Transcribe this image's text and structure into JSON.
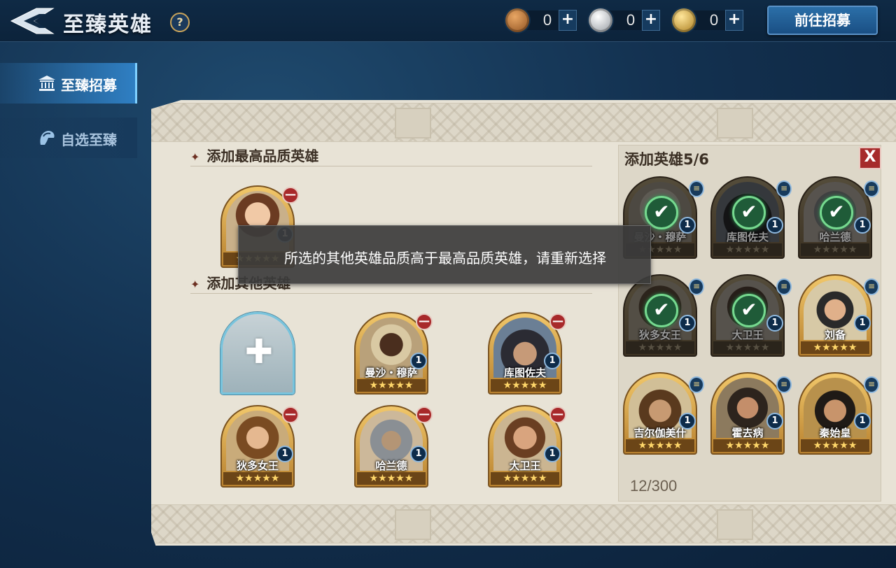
{
  "header": {
    "title": "至臻英雄",
    "help": "?",
    "currencies": [
      {
        "name": "bronze-coin",
        "amount": "0",
        "color": "#b8742e"
      },
      {
        "name": "silver-coin",
        "amount": "0",
        "color": "#c8ccd1"
      },
      {
        "name": "gold-coin",
        "amount": "0",
        "color": "#e2b54a"
      }
    ],
    "plus": "+",
    "go_recruit": "前往招募"
  },
  "side_tabs": [
    {
      "label": "至臻招募",
      "icon": "temple-icon",
      "active": true
    },
    {
      "label": "自选至臻",
      "icon": "helmet-icon",
      "active": false
    }
  ],
  "left": {
    "section1_title": "添加最高品质英雄",
    "section2_title": "添加其他英雄",
    "star_glyph": "✦",
    "top_hero": {
      "name": "",
      "level": "1"
    },
    "other_heroes": [
      {
        "name": "曼沙・穆萨",
        "level": "1"
      },
      {
        "name": "库图佐夫",
        "level": "1"
      },
      {
        "name": "狄多女王",
        "level": "1"
      },
      {
        "name": "哈兰德",
        "level": "1"
      },
      {
        "name": "大卫王",
        "level": "1"
      }
    ],
    "remove_glyph": "—",
    "add_glyph": "✚"
  },
  "right": {
    "title": "添加英雄5/6",
    "close": "X",
    "count": "12/300",
    "check_glyph": "✔",
    "doc_glyph": "≡",
    "stars": "★★★★★",
    "heroes": [
      {
        "name": "曼沙・穆萨",
        "level": "1",
        "selected": true
      },
      {
        "name": "库图佐夫",
        "level": "1",
        "selected": true
      },
      {
        "name": "哈兰德",
        "level": "1",
        "selected": true
      },
      {
        "name": "狄多女王",
        "level": "1",
        "selected": true
      },
      {
        "name": "大卫王",
        "level": "1",
        "selected": true
      },
      {
        "name": "刘备",
        "level": "1",
        "selected": false
      },
      {
        "name": "吉尔伽美什",
        "level": "1",
        "selected": false
      },
      {
        "name": "霍去病",
        "level": "1",
        "selected": false
      },
      {
        "name": "秦始皇",
        "level": "1",
        "selected": false
      }
    ]
  },
  "toast": {
    "message": "所选的其他英雄品质高于最高品质英雄，请重新选择"
  },
  "colors": {
    "accent_blue": "#2f7fc3",
    "danger_red": "#a62b2b",
    "gold_frame": "#f1c76a",
    "check_green": "#76d98f"
  }
}
